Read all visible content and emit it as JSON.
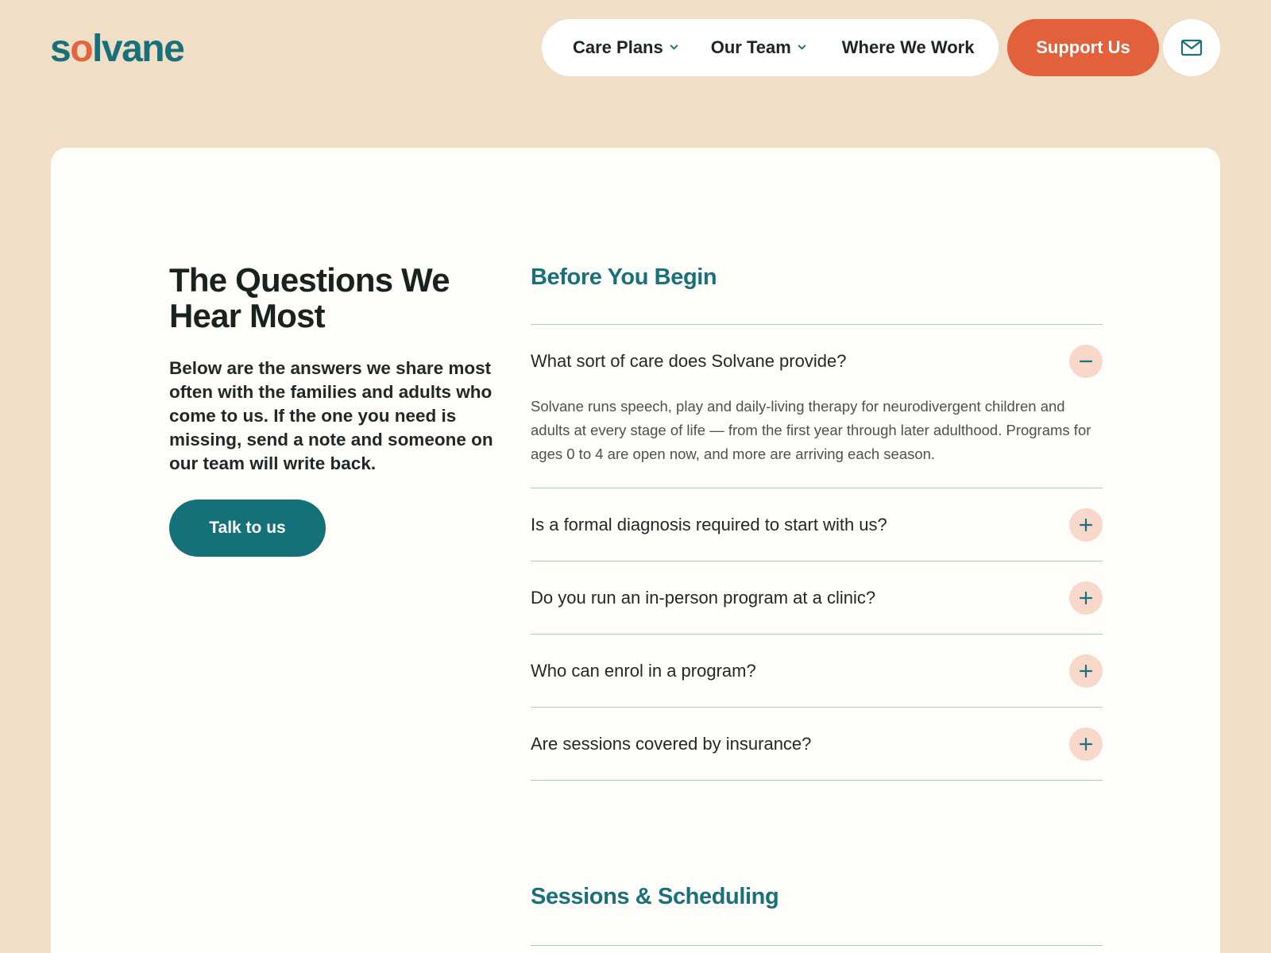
{
  "brand": {
    "logo_start": "s",
    "logo_accent": "o",
    "logo_end": "lvane",
    "primary_color": "#17707a",
    "accent_color": "#e2653e"
  },
  "nav": {
    "items": [
      {
        "label": "Care Plans",
        "has_dropdown": true
      },
      {
        "label": "Our Team",
        "has_dropdown": true
      },
      {
        "label": "Where We Work",
        "has_dropdown": false
      }
    ],
    "support_label": "Support Us",
    "mail_icon": "mail-icon"
  },
  "intro": {
    "title": "The Questions We Hear Most",
    "text": "Below are the answers we share most often with the families and adults who come to us. If the one you need is missing, send a note and someone on our team will write back.",
    "cta_label": "Talk to us"
  },
  "sections": [
    {
      "title": "Before You Begin",
      "faqs": [
        {
          "question": "What sort of care does Solvane provide?",
          "open": true,
          "answer": "Solvane runs speech, play and daily-living therapy for neurodivergent children and adults at every stage of life — from the first year through later adulthood. Programs for ages 0 to 4 are open now, and more are arriving each season."
        },
        {
          "question": "Is a formal diagnosis required to start with us?",
          "open": false
        },
        {
          "question": "Do you run an in-person program at a clinic?",
          "open": false
        },
        {
          "question": "Who can enrol in a program?",
          "open": false
        },
        {
          "question": "Are sessions covered by insurance?",
          "open": false
        }
      ]
    },
    {
      "title": "Sessions & Scheduling"
    }
  ]
}
